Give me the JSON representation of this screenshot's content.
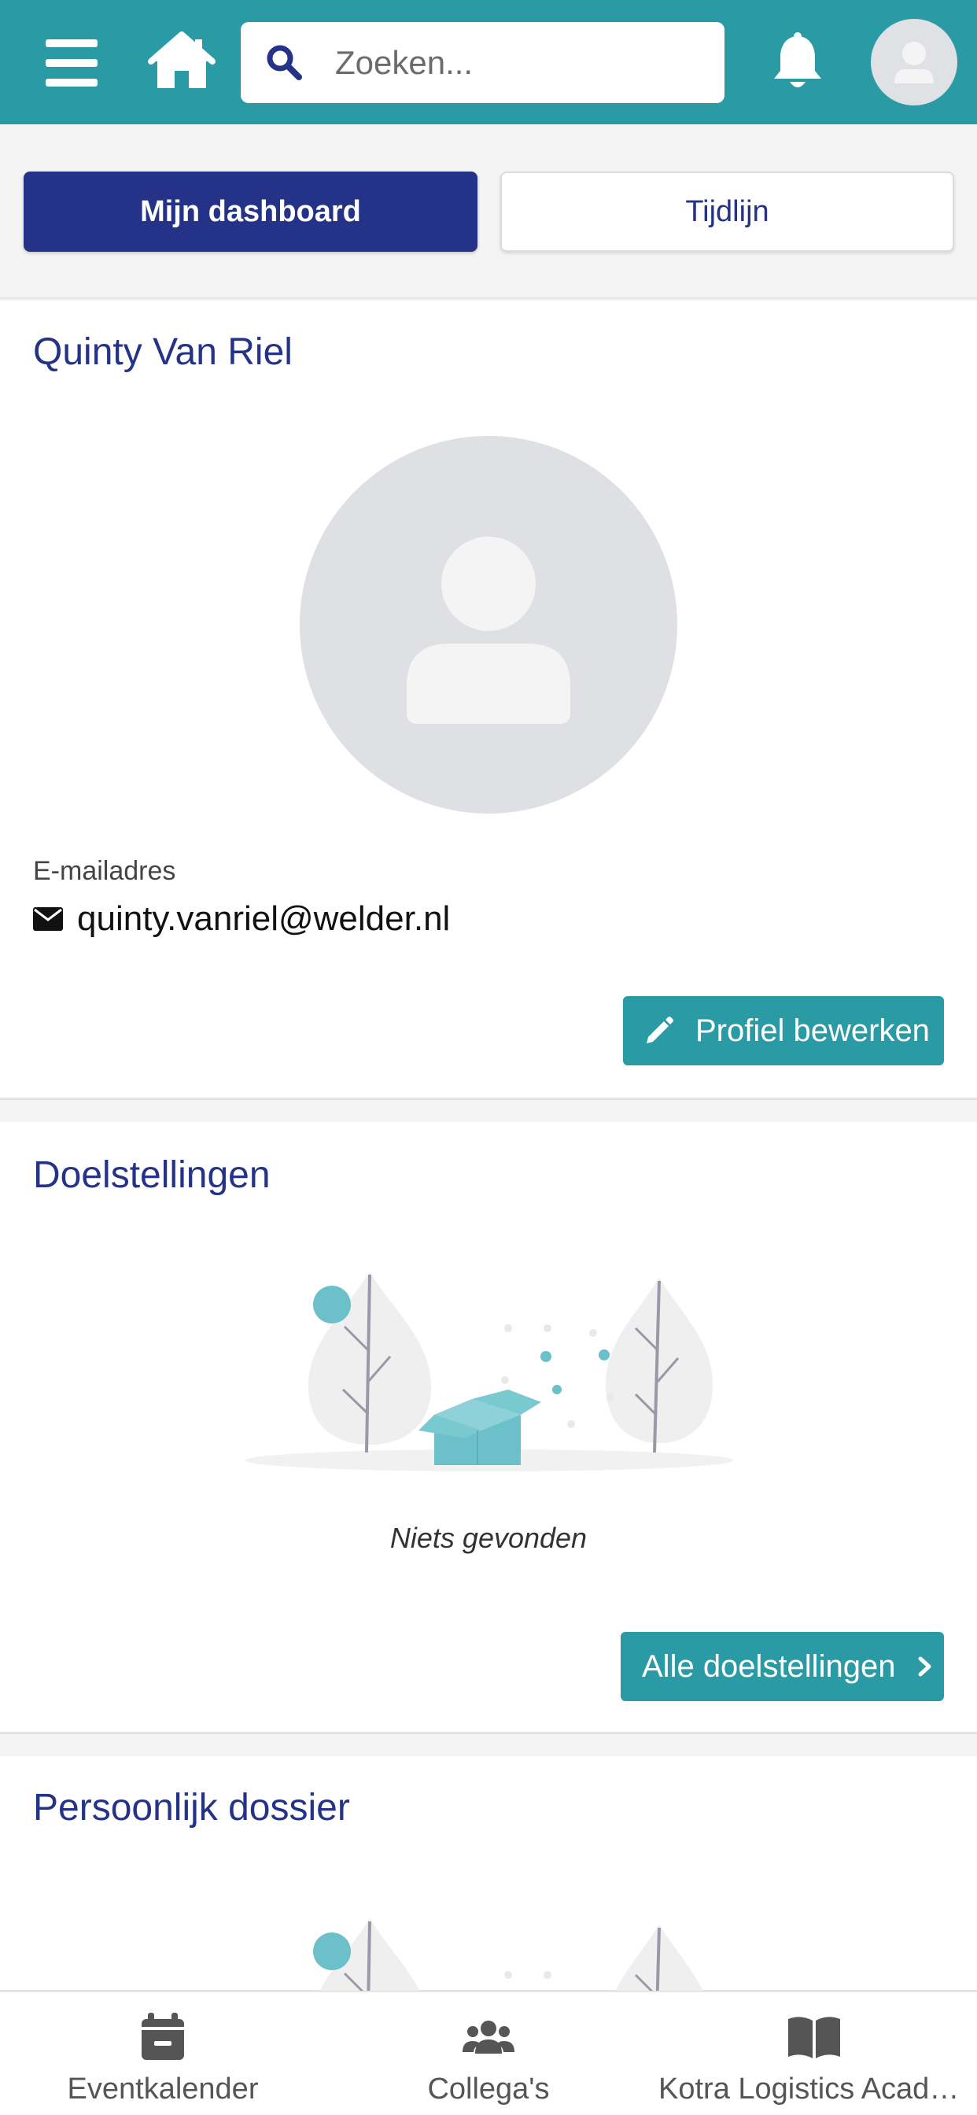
{
  "header": {
    "search_placeholder": "Zoeken...",
    "brand_color": "#2a9ba5"
  },
  "tabs": [
    {
      "label": "Mijn dashboard",
      "active": true
    },
    {
      "label": "Tijdlijn",
      "active": false
    }
  ],
  "profile": {
    "name": "Quinty Van Riel",
    "email_label": "E-mailadres",
    "email": "quinty.vanriel@welder.nl",
    "edit_button": "Profiel bewerken"
  },
  "goals": {
    "title": "Doelstellingen",
    "empty_text": "Niets gevonden",
    "all_button": "Alle doelstellingen"
  },
  "dossier": {
    "title": "Persoonlijk dossier"
  },
  "bottom_nav": [
    {
      "label": "Eventkalender",
      "icon": "calendar-icon"
    },
    {
      "label": "Collega's",
      "icon": "users-icon"
    },
    {
      "label": "Kotra Logistics Academy",
      "icon": "book-icon"
    }
  ],
  "colors": {
    "primary_navy": "#243387",
    "teal": "#2a9ba5"
  }
}
